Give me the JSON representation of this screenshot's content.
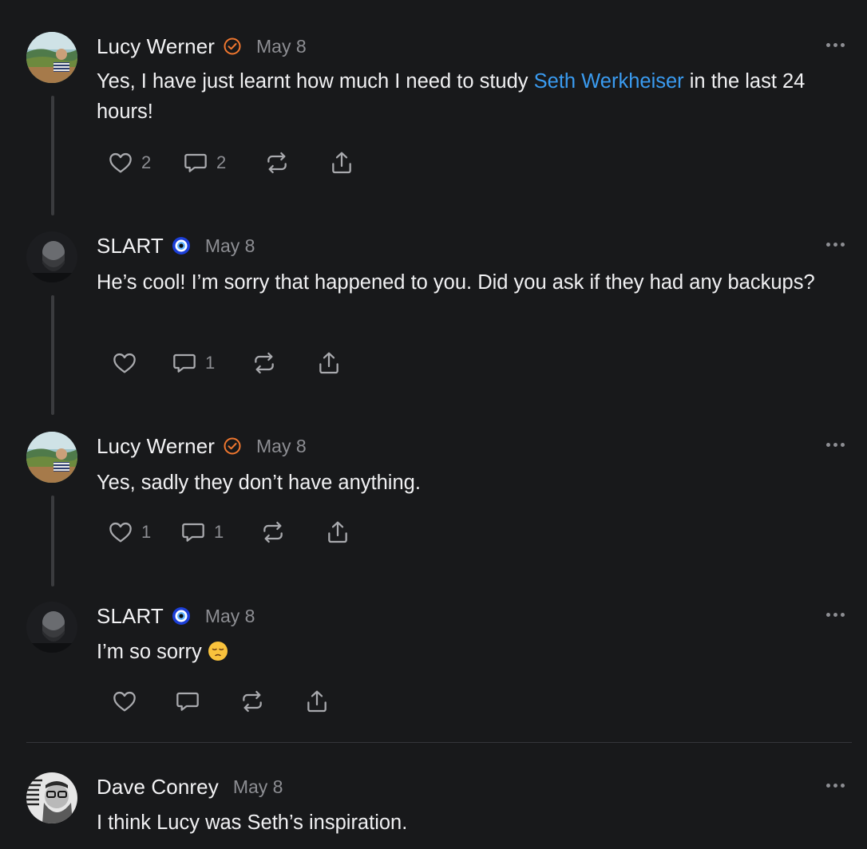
{
  "comments": [
    {
      "author": "Lucy Werner",
      "date": "May 8",
      "text_before": "Yes, I have just learnt how much I need to study ",
      "mention": "Seth Werkheiser",
      "text_after": " in the last 24 hours!",
      "likes": "2",
      "replies": "2",
      "badge_icon": "orange-check-badge-icon",
      "badge_color": "#f0772f"
    },
    {
      "author": "SLART",
      "date": "May 8",
      "text": "He’s cool! I’m sorry that happened to you. Did you ask if they had any backups?",
      "likes": "",
      "replies": "1",
      "badge_icon": "nazar-eye-icon",
      "badge_color": "#1c3fd8"
    },
    {
      "author": "Lucy Werner",
      "date": "May 8",
      "text": "Yes, sadly they don’t have anything.",
      "likes": "1",
      "replies": "1",
      "badge_icon": "orange-check-badge-icon",
      "badge_color": "#f0772f"
    },
    {
      "author": "SLART",
      "date": "May 8",
      "text": "I’m so sorry",
      "emoji": "pensive-face-emoji",
      "likes": "",
      "replies": "",
      "badge_icon": "nazar-eye-icon",
      "badge_color": "#1c3fd8"
    },
    {
      "author": "Dave Conrey",
      "date": "May 8",
      "text": "I think Lucy was Seth’s inspiration."
    }
  ],
  "colors": {
    "background": "#18191b",
    "mention": "#3a9bf0",
    "muted": "#8d8e93"
  }
}
